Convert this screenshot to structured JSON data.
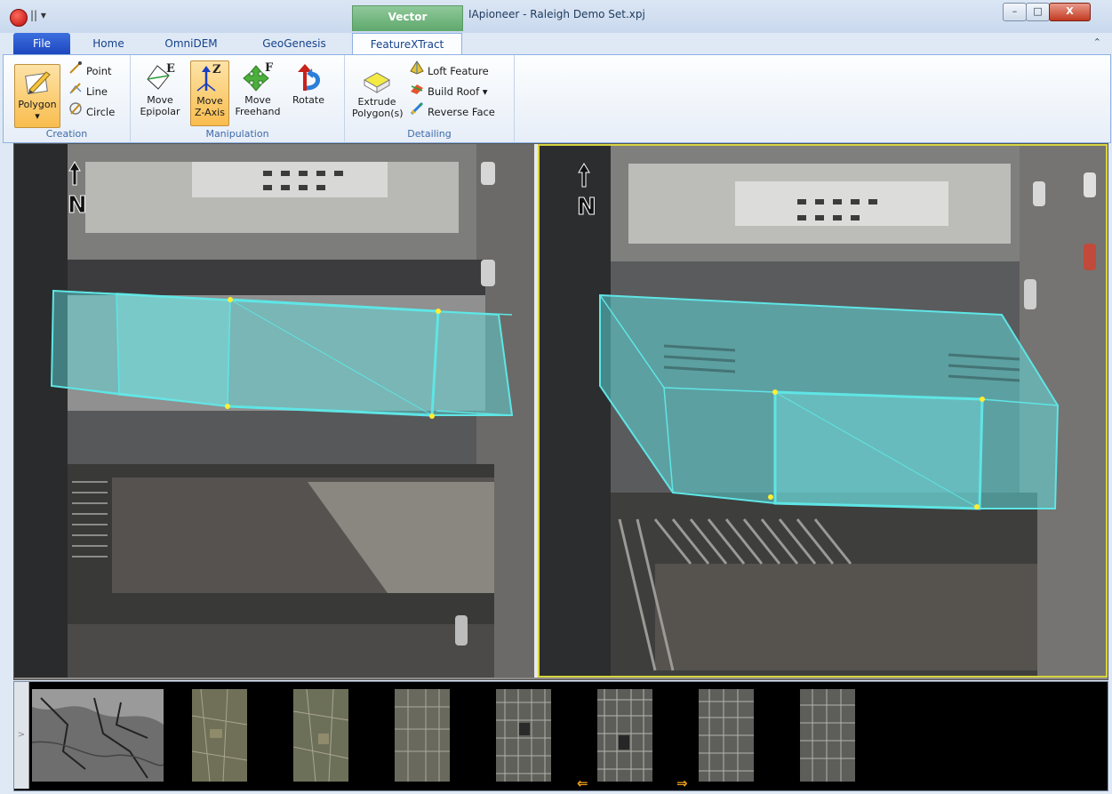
{
  "window": {
    "title": "IApioneer - Raleigh Demo Set.xpj",
    "context_group": "Vector",
    "controls": {
      "minimize": "–",
      "maximize": "□",
      "close": "X"
    }
  },
  "qat": {
    "glyph": "||"
  },
  "tabs": [
    "File",
    "Home",
    "OmniDEM",
    "GeoGenesis",
    "FeatureXTract"
  ],
  "active_tab": "FeatureXTract",
  "ribbon": {
    "groups": [
      {
        "label": "Creation",
        "buttons": [
          {
            "label": "Polygon",
            "icon": "polygon-icon",
            "size": "large",
            "selected": true
          },
          {
            "label": "Point",
            "icon": "point-icon"
          },
          {
            "label": "Line",
            "icon": "line-icon"
          },
          {
            "label": "Circle",
            "icon": "circle-icon"
          }
        ]
      },
      {
        "label": "Manipulation",
        "buttons": [
          {
            "label": "Move Epipolar",
            "icon": "move-epipolar-icon",
            "badge": "E"
          },
          {
            "label": "Move Z-Axis",
            "icon": "move-z-axis-icon",
            "badge": "Z",
            "selected": true
          },
          {
            "label": "Move Freehand",
            "icon": "move-freehand-icon",
            "badge": "F"
          },
          {
            "label": "Rotate",
            "icon": "rotate-icon"
          }
        ]
      },
      {
        "label": "Detailing",
        "buttons": [
          {
            "label": "Extrude Polygon(s)",
            "icon": "extrude-icon"
          },
          {
            "label": "Loft Feature",
            "icon": "loft-icon"
          },
          {
            "label": "Build Roof",
            "icon": "build-roof-icon",
            "dropdown": true
          },
          {
            "label": "Reverse Face",
            "icon": "reverse-face-icon"
          }
        ]
      }
    ]
  },
  "viewer": {
    "north_label": "N",
    "panes": [
      "left-stereo-pane",
      "right-stereo-pane"
    ],
    "active_pane": "right-stereo-pane",
    "colors": {
      "feature_cyan": "#5fe5e5",
      "vertex_yellow": "#ffee33",
      "active_border": "#d8d440"
    }
  },
  "thumbnails": {
    "count": 8,
    "items": [
      "dem-hillshade",
      "aerial-1",
      "aerial-2",
      "aerial-3",
      "aerial-4",
      "aerial-5",
      "aerial-6",
      "aerial-7"
    ],
    "prev_glyph": "⇐",
    "next_glyph": "⇒"
  }
}
